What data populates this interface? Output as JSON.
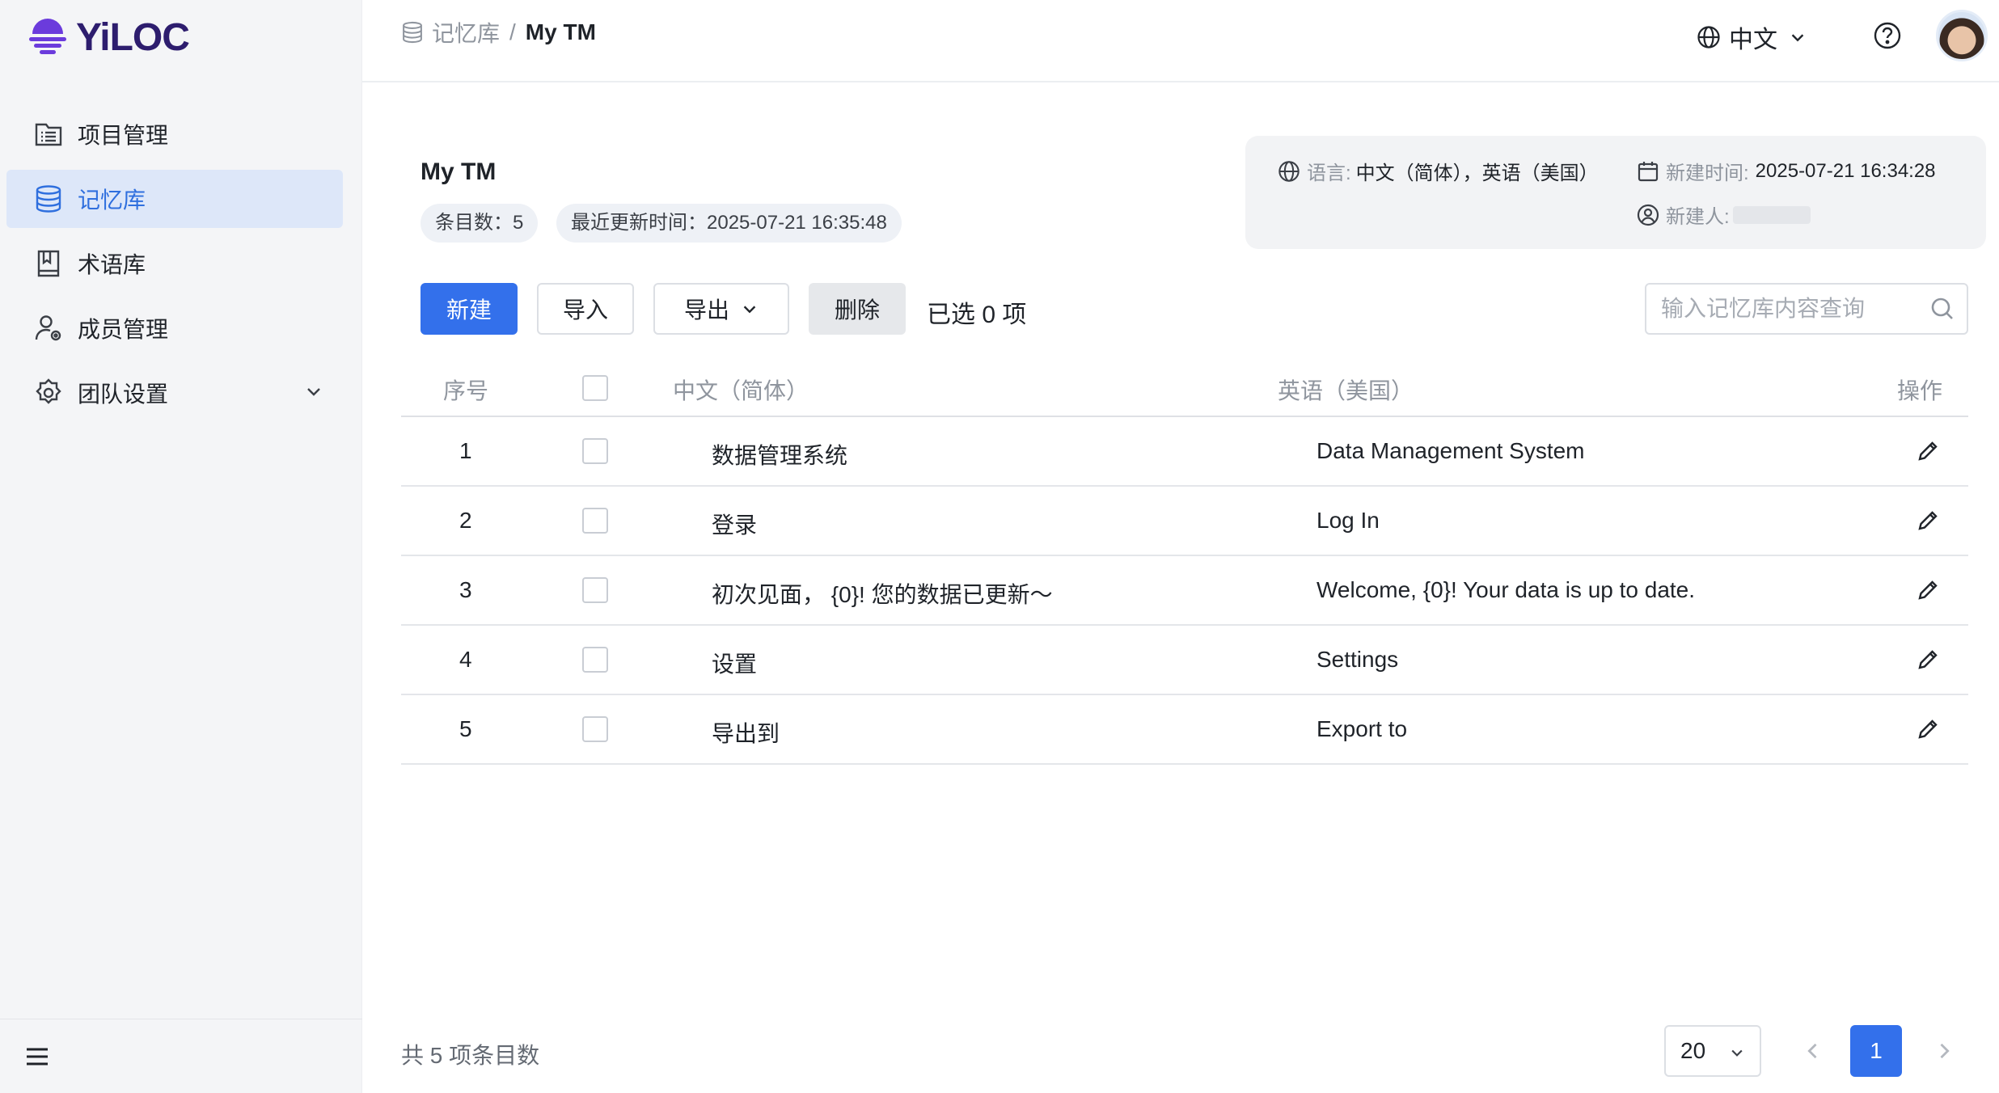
{
  "app": {
    "logo_text": "YiLOC"
  },
  "sidebar": {
    "items": [
      {
        "label": "项目管理",
        "icon": "project-list-icon",
        "active": false
      },
      {
        "label": "记忆库",
        "icon": "database-icon",
        "active": true
      },
      {
        "label": "术语库",
        "icon": "book-icon",
        "active": false
      },
      {
        "label": "成员管理",
        "icon": "user-settings-icon",
        "active": false
      },
      {
        "label": "团队设置",
        "icon": "gear-icon",
        "active": false,
        "expandable": true
      }
    ],
    "footer_icon": "menu-icon"
  },
  "header": {
    "breadcrumb": {
      "parent": "记忆库",
      "separator": "/",
      "current": "My TM"
    },
    "language": "中文",
    "help_icon": "help-icon"
  },
  "tm": {
    "title": "My TM",
    "entry_count_label": "条目数：5",
    "updated_label": "最近更新时间：2025-07-21 16:35:48",
    "language_label": "语言:",
    "language_value": "中文（简体），英语（美国）",
    "created_label": "新建时间:",
    "created_value": "2025-07-21 16:34:28",
    "creator_label": "新建人:"
  },
  "toolbar": {
    "new_label": "新建",
    "import_label": "导入",
    "export_label": "导出",
    "delete_label": "删除",
    "selected_text": "已选 0 项",
    "search_placeholder": "输入记忆库内容查询"
  },
  "table": {
    "headers": {
      "index": "序号",
      "source": "中文（简体）",
      "target": "英语（美国）",
      "actions": "操作"
    },
    "rows": [
      {
        "index": "1",
        "source": "数据管理系统",
        "target": "Data Management System"
      },
      {
        "index": "2",
        "source": "登录",
        "target": "Log In"
      },
      {
        "index": "3",
        "source": "初次见面， {0}! 您的数据已更新～",
        "target": "Welcome, {0}! Your data is up to date."
      },
      {
        "index": "4",
        "source": "设置",
        "target": "Settings"
      },
      {
        "index": "5",
        "source": "导出到",
        "target": "Export to"
      }
    ]
  },
  "pagination": {
    "total_text": "共 5 项条目数",
    "page_size": "20",
    "current_page": "1"
  },
  "colors": {
    "primary": "#3370eb",
    "sidebar_active_bg": "#dde7f9",
    "logo_purple": "#6b3bdc"
  }
}
